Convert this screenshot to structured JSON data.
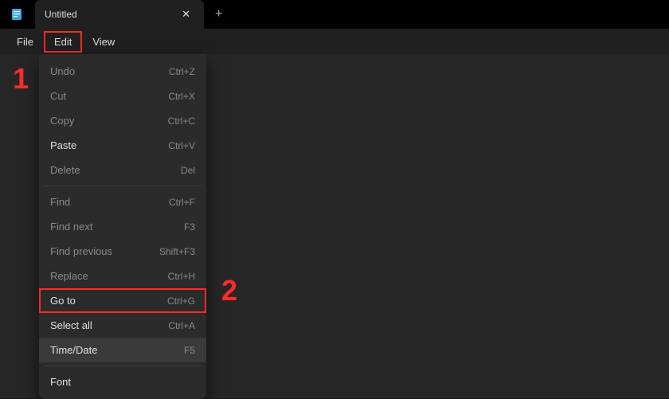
{
  "titlebar": {
    "tab_title": "Untitled"
  },
  "menubar": {
    "items": [
      {
        "label": "File"
      },
      {
        "label": "Edit",
        "active": true
      },
      {
        "label": "View"
      }
    ]
  },
  "edit_menu": {
    "groups": [
      [
        {
          "label": "Undo",
          "shortcut": "Ctrl+Z",
          "disabled": true
        },
        {
          "label": "Cut",
          "shortcut": "Ctrl+X",
          "disabled": true
        },
        {
          "label": "Copy",
          "shortcut": "Ctrl+C",
          "disabled": true
        },
        {
          "label": "Paste",
          "shortcut": "Ctrl+V",
          "disabled": false
        },
        {
          "label": "Delete",
          "shortcut": "Del",
          "disabled": true
        }
      ],
      [
        {
          "label": "Find",
          "shortcut": "Ctrl+F",
          "disabled": true
        },
        {
          "label": "Find next",
          "shortcut": "F3",
          "disabled": true
        },
        {
          "label": "Find previous",
          "shortcut": "Shift+F3",
          "disabled": true
        },
        {
          "label": "Replace",
          "shortcut": "Ctrl+H",
          "disabled": true
        },
        {
          "label": "Go to",
          "shortcut": "Ctrl+G",
          "disabled": false,
          "highlight": true
        },
        {
          "label": "Select all",
          "shortcut": "Ctrl+A",
          "disabled": false
        },
        {
          "label": "Time/Date",
          "shortcut": "F5",
          "disabled": false,
          "hover": true
        }
      ],
      [
        {
          "label": "Font",
          "shortcut": "",
          "disabled": false
        }
      ]
    ]
  },
  "annotations": {
    "a1": "1",
    "a2": "2"
  },
  "colors": {
    "highlight": "#ff2b2b",
    "bg": "#1a1a1a",
    "panel": "#2b2b2b"
  }
}
